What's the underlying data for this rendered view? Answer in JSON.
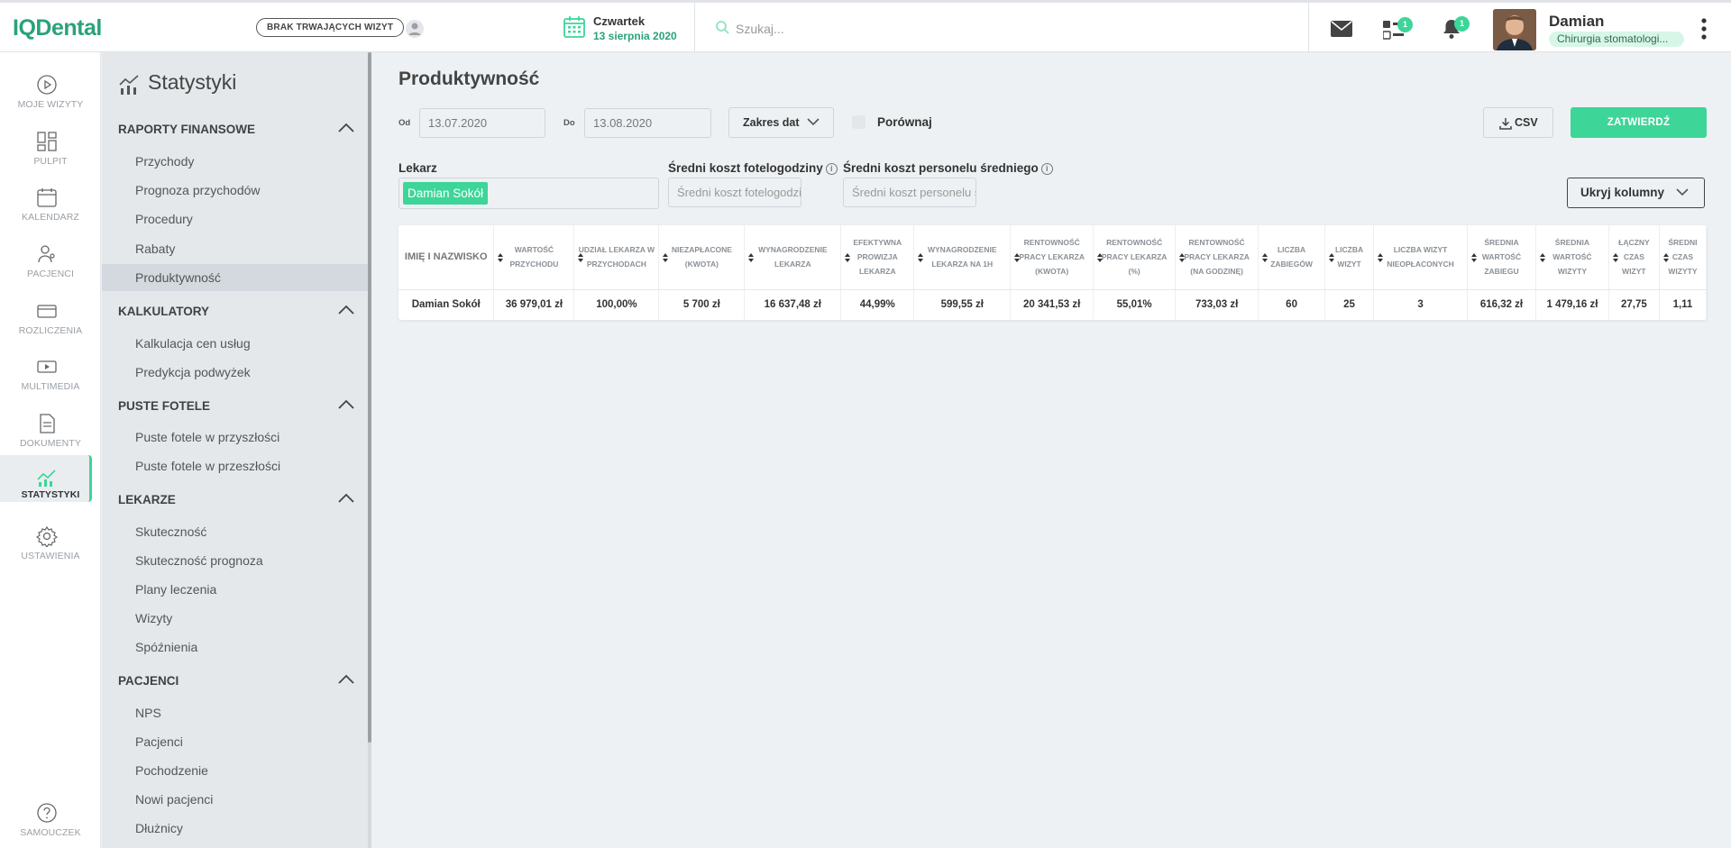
{
  "app": {
    "logo": "IQDental",
    "no_visits": "BRAK TRWAJĄCYCH WIZYT",
    "date_day": "Czwartek",
    "date_full": "13 sierpnia 2020",
    "search_placeholder": "Szukaj...",
    "tasks_badge": "1",
    "notifications_badge": "1",
    "user_name": "Damian",
    "user_role": "Chirurgia stomatologi..."
  },
  "leftnav": [
    {
      "label": "MOJE WIZYTY",
      "icon": "play-circle-icon"
    },
    {
      "label": "PULPIT",
      "icon": "dashboard-icon"
    },
    {
      "label": "KALENDARZ",
      "icon": "calendar-icon"
    },
    {
      "label": "PACJENCI",
      "icon": "patients-icon"
    },
    {
      "label": "ROZLICZENIA",
      "icon": "card-icon"
    },
    {
      "label": "MULTIMEDIA",
      "icon": "media-icon"
    },
    {
      "label": "DOKUMENTY",
      "icon": "document-icon"
    },
    {
      "label": "STATYSTYKI",
      "icon": "stats-icon",
      "active": true
    },
    {
      "label": "USTAWIENIA",
      "icon": "gear-icon"
    },
    {
      "label": "SAMOUCZEK",
      "icon": "help-icon"
    }
  ],
  "stats": {
    "title": "Statystyki",
    "sections": [
      {
        "title": "RAPORTY FINANSOWE",
        "links": [
          "Przychody",
          "Prognoza przychodów",
          "Procedury",
          "Rabaty",
          "Produktywność"
        ]
      },
      {
        "title": "KALKULATORY",
        "links": [
          "Kalkulacja cen usług",
          "Predykcja podwyżek"
        ]
      },
      {
        "title": "PUSTE FOTELE",
        "links": [
          "Puste fotele w przyszłości",
          "Puste fotele w przeszłości"
        ]
      },
      {
        "title": "LEKARZE",
        "links": [
          "Skuteczność",
          "Skuteczność prognoza",
          "Plany leczenia",
          "Wizyty",
          "Spóźnienia"
        ]
      },
      {
        "title": "PACJENCI",
        "links": [
          "NPS",
          "Pacjenci",
          "Pochodzenie",
          "Nowi pacjenci",
          "Dłużnicy"
        ]
      }
    ],
    "active_link": "Produktywność"
  },
  "main": {
    "title": "Produktywność",
    "from_label": "Od",
    "from_value": "13.07.2020",
    "to_label": "Do",
    "to_value": "13.08.2020",
    "range_button": "Zakres dat",
    "compare_label": "Porównaj",
    "csv_button": "CSV",
    "submit_button": "ZATWIERDŹ",
    "doctor_label": "Lekarz",
    "doctor_chip": "Damian Sokół",
    "chair_cost_label": "Średni koszt fotelogodziny",
    "chair_cost_placeholder": "Średni koszt fotelogodziny",
    "staff_cost_label": "Średni koszt personelu średniego",
    "staff_cost_placeholder": "Średni koszt personelu średniego",
    "hide_columns": "Ukryj kolumny"
  },
  "table": {
    "headers": [
      "IMIĘ I NAZWISKO",
      "WARTOŚĆ PRZYCHODU",
      "UDZIAŁ LEKARZA W PRZYCHODACH",
      "NIEZAPŁACONE (KWOTA)",
      "WYNAGRODZENIE LEKARZA",
      "EFEKTYWNA PROWIZJA LEKARZA",
      "WYNAGRODZENIE LEKARZA NA 1H",
      "RENTOWNOŚĆ PRACY LEKARZA (KWOTA)",
      "RENTOWNOŚĆ PRACY LEKARZA (%)",
      "RENTOWNOŚĆ PRACY LEKARZA (NA GODZINĘ)",
      "LICZBA ZABIEGÓW",
      "LICZBA WIZYT",
      "LICZBA WIZYT NIEOPŁACONYCH",
      "ŚREDNIA WARTOŚĆ ZABIEGU",
      "ŚREDNIA WARTOŚĆ WIZYTY",
      "ŁĄCZNY CZAS WIZYT",
      "ŚREDNI CZAS WIZYTY"
    ],
    "rows": [
      [
        "Damian Sokół",
        "36 979,01 zł",
        "100,00%",
        "5 700 zł",
        "16 637,48 zł",
        "44,99%",
        "599,55 zł",
        "20 341,53 zł",
        "55,01%",
        "733,03 zł",
        "60",
        "25",
        "3",
        "616,32 zł",
        "1 479,16 zł",
        "27,75",
        "1,11"
      ]
    ]
  },
  "colors": {
    "accent": "#3dd598",
    "brand": "#2aa27a"
  }
}
